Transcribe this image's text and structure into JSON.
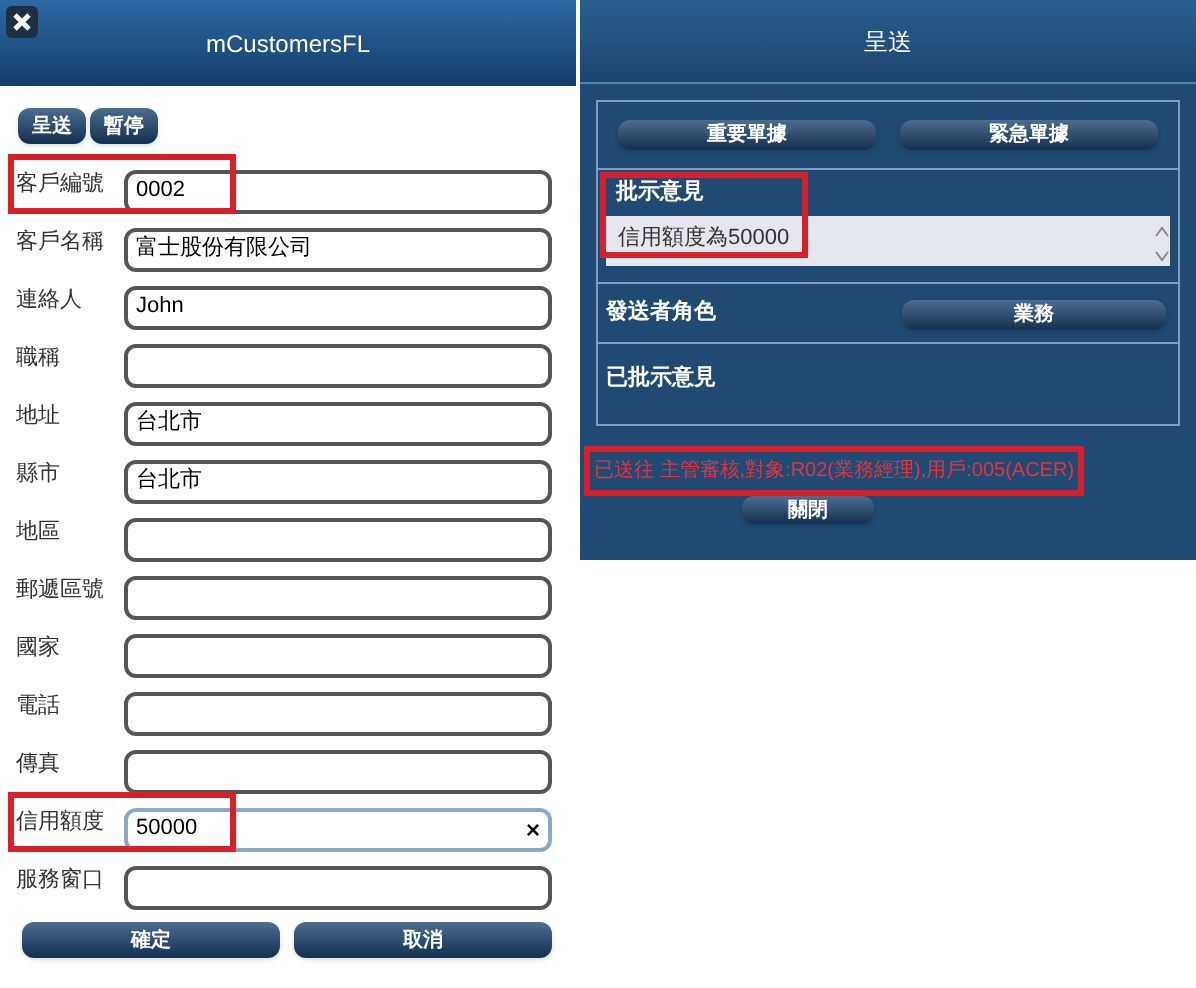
{
  "form_window": {
    "title": "mCustomersFL",
    "top_buttons": [
      "呈送",
      "暫停"
    ],
    "fields": [
      {
        "label": "客戶編號",
        "value": "0002",
        "highlighted": true,
        "clearable": false
      },
      {
        "label": "客戶名稱",
        "value": "富士股份有限公司",
        "highlighted": false,
        "clearable": false
      },
      {
        "label": "連絡人",
        "value": "John",
        "highlighted": false,
        "clearable": false
      },
      {
        "label": "職稱",
        "highlighted": false,
        "clearable": false
      },
      {
        "label": "地址",
        "value": "台北市",
        "highlighted": false,
        "clearable": false
      },
      {
        "label": "縣市",
        "value": "台北市",
        "highlighted": false,
        "clearable": false
      },
      {
        "label": "地區",
        "highlighted": false,
        "clearable": false
      },
      {
        "label": "郵遞區號",
        "highlighted": false,
        "clearable": false
      },
      {
        "label": "國家",
        "highlighted": false,
        "clearable": false
      },
      {
        "label": "電話",
        "highlighted": false,
        "clearable": false
      },
      {
        "label": "傳真",
        "highlighted": false,
        "clearable": false
      },
      {
        "label": "信用額度",
        "value": "50000",
        "highlighted": true,
        "clearable": true,
        "clear_symbol": "×"
      },
      {
        "label": "服務窗口",
        "highlighted": false,
        "clearable": false
      }
    ],
    "bottom_buttons": [
      "確定",
      "取消"
    ]
  },
  "submit_dialog": {
    "title": "呈送",
    "priority_buttons": [
      "重要單據",
      "緊急單據"
    ],
    "comment": {
      "label": "批示意見",
      "value": "信用額度為50000",
      "highlighted": true
    },
    "sender_role": {
      "label": "發送者角色",
      "value": "業務"
    },
    "approved_comments": {
      "label": "已批示意見"
    },
    "message": {
      "text": "已送往 主管審核,對象:R02(業務經理),用戶:005(ACER)",
      "highlighted": true
    },
    "close_button": "關閉"
  }
}
